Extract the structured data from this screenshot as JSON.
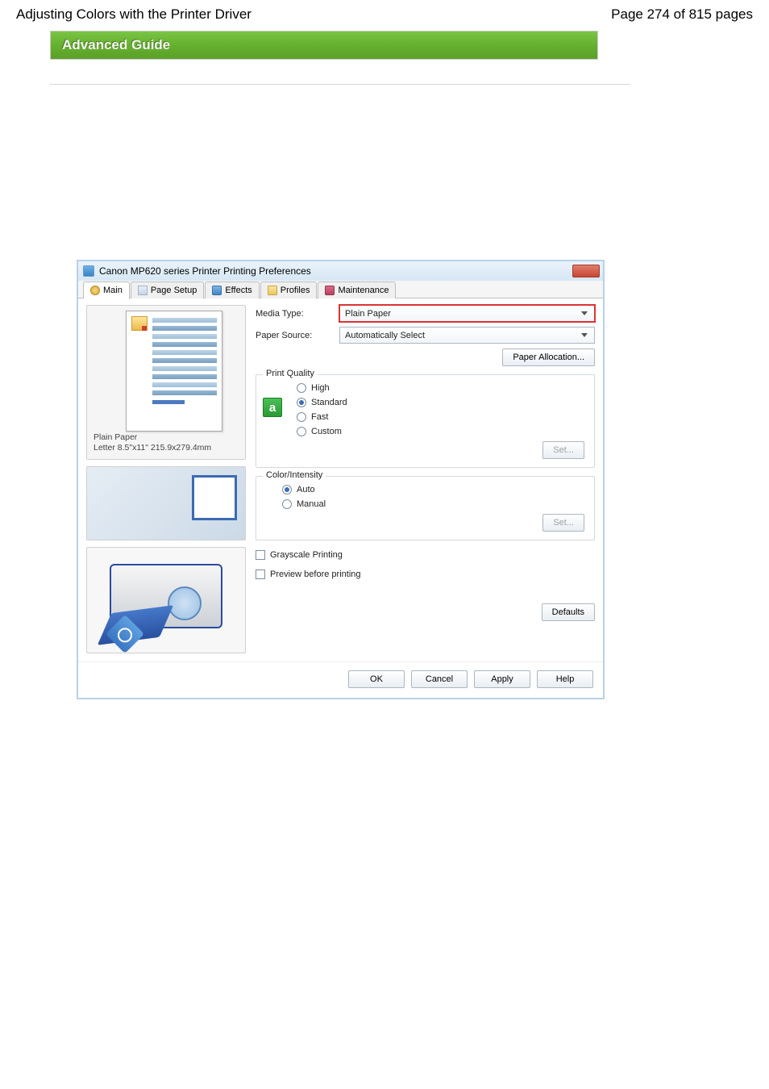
{
  "header": {
    "left": "Adjusting Colors with the Printer Driver",
    "right": "Page 274 of 815 pages"
  },
  "banner": "Advanced Guide",
  "dialog": {
    "title": "Canon MP620 series Printer Printing Preferences",
    "tabs": [
      {
        "label": "Main"
      },
      {
        "label": "Page Setup"
      },
      {
        "label": "Effects"
      },
      {
        "label": "Profiles"
      },
      {
        "label": "Maintenance"
      }
    ],
    "preview": {
      "paper_label": "Plain Paper",
      "size_label": "Letter 8.5\"x11\" 215.9x279.4mm"
    },
    "media_type": {
      "label": "Media Type:",
      "value": "Plain Paper"
    },
    "paper_source": {
      "label": "Paper Source:",
      "value": "Automatically Select"
    },
    "paper_allocation_btn": "Paper Allocation...",
    "print_quality": {
      "title": "Print Quality",
      "icon_letter": "a",
      "options": {
        "high": "High",
        "standard": "Standard",
        "fast": "Fast",
        "custom": "Custom"
      },
      "set_btn": "Set..."
    },
    "color_intensity": {
      "title": "Color/Intensity",
      "options": {
        "auto": "Auto",
        "manual": "Manual"
      },
      "set_btn": "Set..."
    },
    "grayscale_label": "Grayscale Printing",
    "preview_before_label": "Preview before printing",
    "defaults_btn": "Defaults",
    "footer": {
      "ok": "OK",
      "cancel": "Cancel",
      "apply": "Apply",
      "help": "Help"
    }
  }
}
